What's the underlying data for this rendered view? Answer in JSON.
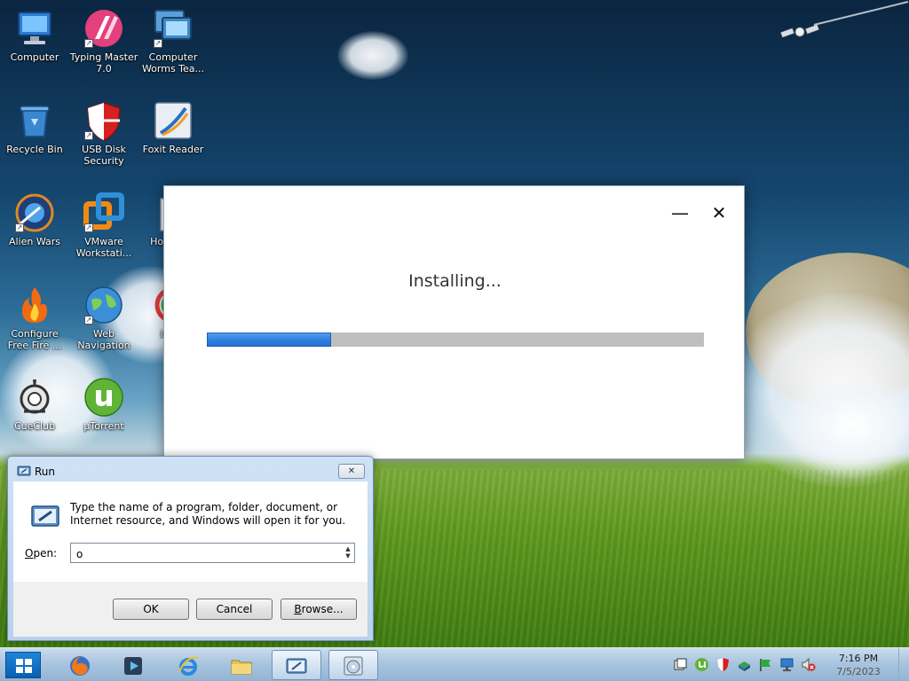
{
  "desktop": {
    "icons": [
      {
        "label": "Computer",
        "icon": "computer-icon"
      },
      {
        "label": "Typing Master 7.0",
        "icon": "typing-master-icon"
      },
      {
        "label": "Computer Worms Tea...",
        "icon": "computer-worms-icon"
      },
      {
        "label": "Recycle Bin",
        "icon": "recycle-bin-icon"
      },
      {
        "label": "USB Disk Security",
        "icon": "usb-disk-security-icon"
      },
      {
        "label": "Foxit Reader",
        "icon": "foxit-reader-icon"
      },
      {
        "label": "Alien Wars",
        "icon": "alien-wars-icon"
      },
      {
        "label": "VMware Workstati...",
        "icon": "vmware-icon"
      },
      {
        "label": "How Blue",
        "icon": "document-icon"
      },
      {
        "label": "Configure Free Fire ...",
        "icon": "free-fire-icon"
      },
      {
        "label": "Web Navigation",
        "icon": "globe-icon"
      },
      {
        "label": "In Do",
        "icon": "colorful-app-icon"
      },
      {
        "label": "CueClub",
        "icon": "cueclub-icon"
      },
      {
        "label": "µTorrent",
        "icon": "utorrent-icon"
      }
    ]
  },
  "installer": {
    "status": "Installing...",
    "progress": 0.25,
    "minimize_glyph": "—",
    "close_glyph": "✕"
  },
  "run_dialog": {
    "title": "Run",
    "close_glyph": "✕",
    "description": "Type the name of a program, folder, document, or Internet resource, and Windows will open it for you.",
    "open_label_accel": "O",
    "open_label_rest": "pen:",
    "open_value": "o",
    "ok_label": "OK",
    "cancel_label": "Cancel",
    "browse_accel": "B",
    "browse_rest": "rowse..."
  },
  "taskbar": {
    "items": [
      {
        "icon": "firefox-icon",
        "active": false
      },
      {
        "icon": "media-player-icon",
        "active": false
      },
      {
        "icon": "internet-explorer-icon",
        "active": false
      },
      {
        "icon": "file-explorer-icon",
        "active": false
      },
      {
        "icon": "run-dialog-icon",
        "active": true
      },
      {
        "icon": "installer-disc-icon",
        "active": true
      }
    ],
    "tray_icons": [
      "action-center-icon",
      "utorrent-tray-icon",
      "usb-security-tray-icon",
      "network-share-icon",
      "flag-icon",
      "network-icon",
      "volume-muted-icon"
    ],
    "time": "7:16 PM",
    "date": "7/5/2023"
  },
  "colors": {
    "progress_fill": "#2f7fe0",
    "progress_track": "#bfbfbf",
    "taskbar": "#a9c5de"
  }
}
